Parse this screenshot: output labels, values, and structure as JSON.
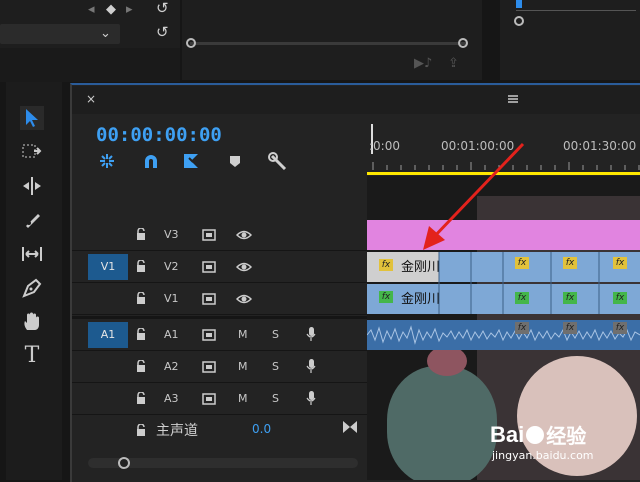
{
  "app": {
    "accent": "#3ea0f3",
    "panel_bg": "#232323",
    "video_clip_color": "#7ea8d6",
    "adjustment_color": "#e184e0",
    "audio_clip_color": "#3b6ea7"
  },
  "top": {
    "undo_icon": "undo-icon",
    "dropdown_icon": "chevron-down-icon"
  },
  "timeline": {
    "menu_icon": "hamburger-menu-icon",
    "close_label": "×",
    "timecode": "00:00:00:00",
    "ruler": {
      "ticks": [
        ":0:00",
        "00:01:00:00",
        "00:01:30:00"
      ]
    },
    "toolbar_icons": [
      "snap-icon",
      "magnet-icon",
      "linked-selection-icon",
      "marker-icon",
      "wrench-icon"
    ],
    "tracks": [
      {
        "name": "V3",
        "type": "video",
        "source": ""
      },
      {
        "name": "V2",
        "type": "video",
        "source": "V1"
      },
      {
        "name": "V1",
        "type": "video",
        "source": ""
      },
      {
        "name": "A1",
        "type": "audio",
        "source": "A1"
      },
      {
        "name": "A2",
        "type": "audio",
        "source": ""
      },
      {
        "name": "A3",
        "type": "audio",
        "source": ""
      }
    ],
    "audio_m": "M",
    "audio_s": "S",
    "master": {
      "label": "主声道",
      "value": "0.0"
    },
    "clips": {
      "v2_name": "金刚川",
      "v1_name": "金刚川",
      "fx": "fx"
    }
  },
  "watermark": {
    "brand": "Bai",
    "suffix": "经验",
    "url": "jingyan.baidu.com"
  }
}
